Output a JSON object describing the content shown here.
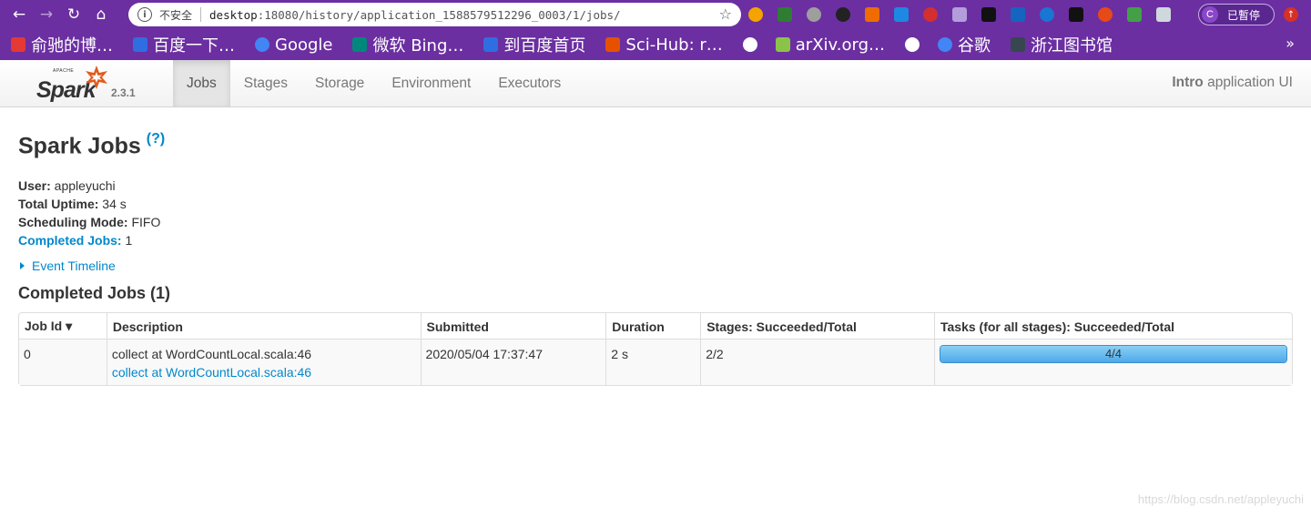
{
  "browser": {
    "security_label": "不安全",
    "url_host": "desktop",
    "url_rest": ":18080/history/application_1588579512296_0003/1/jobs/",
    "profile_label": "已暫停",
    "profile_initial": "C",
    "bookmarks": [
      {
        "label": "俞驰的博…",
        "icon": "csdn-icon",
        "color": "#e53935"
      },
      {
        "label": "百度一下…",
        "icon": "baidu-icon",
        "color": "#2f6ee0"
      },
      {
        "label": "Google",
        "icon": "google-icon",
        "color": "#4285f4"
      },
      {
        "label": "微软 Bing…",
        "icon": "bing-icon",
        "color": "#00897b"
      },
      {
        "label": "到百度首页",
        "icon": "baidu-icon",
        "color": "#2f6ee0"
      },
      {
        "label": "Sci-Hub: r…",
        "icon": "scihub-icon",
        "color": "#e65100"
      },
      {
        "label": "",
        "icon": "globe-icon",
        "color": "#ffffff"
      },
      {
        "label": "arXiv.org…",
        "icon": "arxiv-icon",
        "color": "#8bc34a"
      },
      {
        "label": "",
        "icon": "globe-icon",
        "color": "#ffffff"
      },
      {
        "label": "谷歌",
        "icon": "google-icon",
        "color": "#4285f4"
      },
      {
        "label": "浙江图书馆",
        "icon": "library-icon",
        "color": "#37474f"
      }
    ],
    "more_label": "»"
  },
  "navbar": {
    "brand_version": "2.3.1",
    "tabs": [
      "Jobs",
      "Stages",
      "Storage",
      "Environment",
      "Executors"
    ],
    "active_tab": "Jobs",
    "app_title_bold": "Intro",
    "app_title_rest": " application UI"
  },
  "page": {
    "title": "Spark Jobs",
    "help": "(?)",
    "user_label": "User:",
    "user_value": " appleyuchi",
    "uptime_label": "Total Uptime:",
    "uptime_value": " 34 s",
    "sched_label": "Scheduling Mode:",
    "sched_value": " FIFO",
    "completed_label": "Completed Jobs:",
    "completed_value": " 1",
    "timeline_label": "Event Timeline",
    "section_title": "Completed Jobs (1)"
  },
  "table": {
    "headers": [
      "Job Id ▾",
      "Description",
      "Submitted",
      "Duration",
      "Stages: Succeeded/Total",
      "Tasks (for all stages): Succeeded/Total"
    ],
    "rows": [
      {
        "job_id": "0",
        "desc_text": "collect at WordCountLocal.scala:46",
        "desc_link": "collect at WordCountLocal.scala:46",
        "submitted": "2020/05/04 17:37:47",
        "duration": "2 s",
        "stages": "2/2",
        "tasks_label": "4/4",
        "tasks_fraction": 1.0
      }
    ]
  },
  "watermark": "https://blog.csdn.net/appleyuchi"
}
